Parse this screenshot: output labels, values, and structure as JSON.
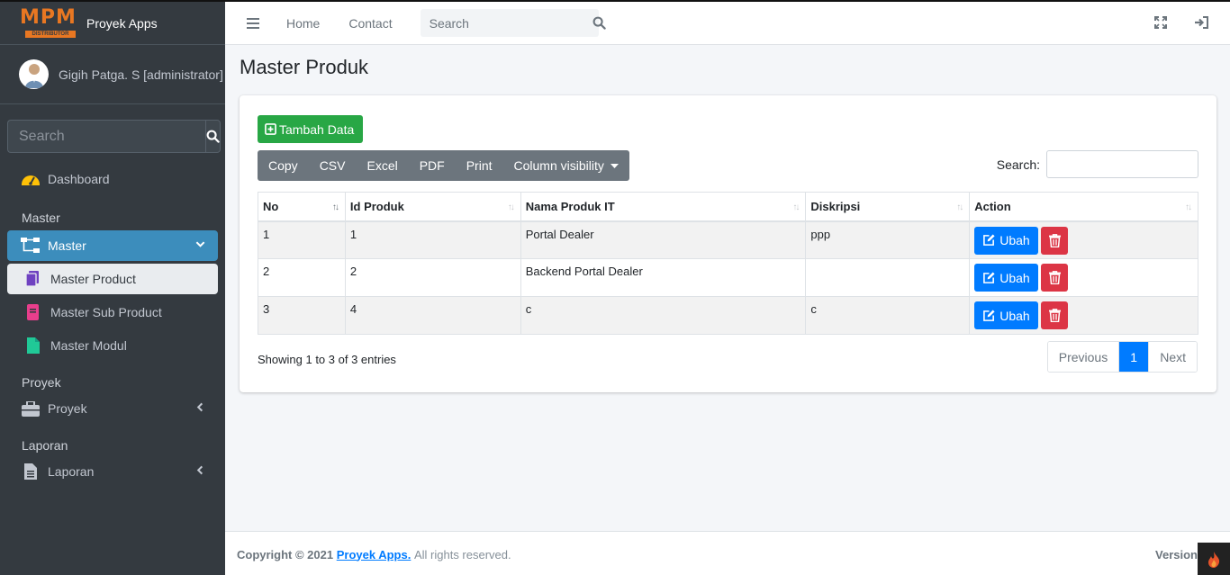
{
  "brand": {
    "logo_text": "MPM",
    "logo_sub": "DISTRIBUTOR",
    "app_name": "Proyek Apps"
  },
  "user": {
    "name": "Gigih Patga. S [administrator]"
  },
  "sidebar": {
    "search_placeholder": "Search",
    "dashboard": "Dashboard",
    "header_master": "Master",
    "master": "Master",
    "master_product": "Master Product",
    "master_sub_product": "Master Sub Product",
    "master_modul": "Master Modul",
    "header_proyek": "Proyek",
    "proyek": "Proyek",
    "header_laporan": "Laporan",
    "laporan": "Laporan"
  },
  "topbar": {
    "home": "Home",
    "contact": "Contact",
    "search_placeholder": "Search"
  },
  "page": {
    "title": "Master Produk"
  },
  "toolbar": {
    "add_label": "Tambah Data",
    "copy": "Copy",
    "csv": "CSV",
    "excel": "Excel",
    "pdf": "PDF",
    "print": "Print",
    "column_visibility": "Column visibility",
    "search_label": "Search:"
  },
  "table": {
    "headers": [
      "No",
      "Id Produk",
      "Nama Produk IT",
      "Diskripsi",
      "Action"
    ],
    "rows": [
      [
        "1",
        "1",
        "Portal Dealer",
        "ppp"
      ],
      [
        "2",
        "2",
        "Backend Portal Dealer",
        ""
      ],
      [
        "3",
        "4",
        "c",
        "c"
      ]
    ],
    "edit_label": "Ubah"
  },
  "info": "Showing 1 to 3 of 3 entries",
  "pagination": {
    "previous": "Previous",
    "current": "1",
    "next": "Next"
  },
  "footer": {
    "copyright": "Copyright © 2021",
    "brand": "Proyek Apps.",
    "rights": "All rights reserved.",
    "version": "Version"
  },
  "colors": {
    "sidebar": "#343a40",
    "active": "#3c8dbc",
    "add": "#28a745",
    "edit": "#007bff",
    "delete": "#dc3545"
  }
}
